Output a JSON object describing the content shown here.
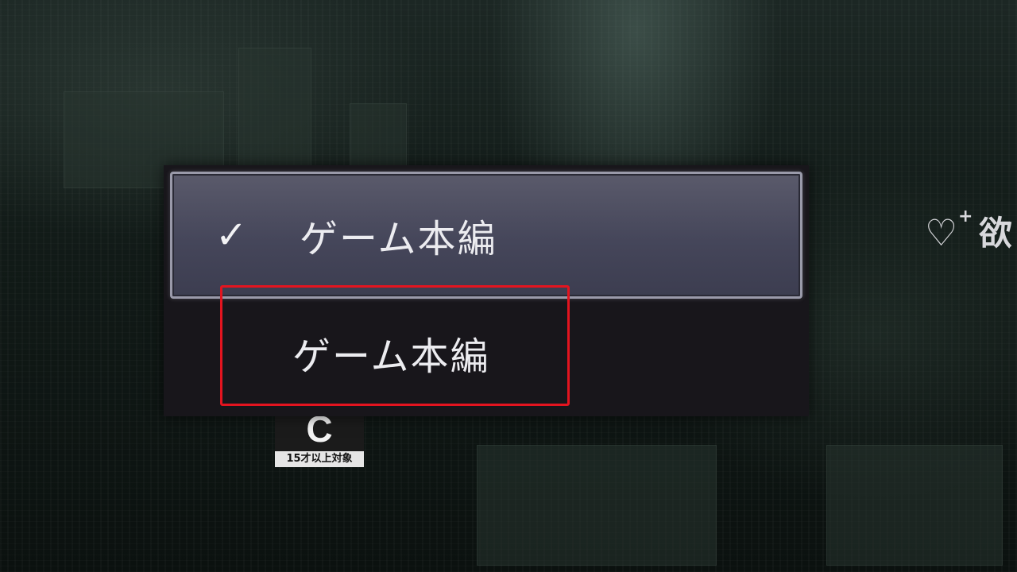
{
  "dropdown": {
    "options": [
      {
        "label": "ゲーム本編",
        "selected": true
      },
      {
        "label": "ゲーム本編",
        "selected": false
      }
    ]
  },
  "rating": {
    "letter": "C",
    "label": "15才以上対象"
  },
  "wishlist": {
    "label": "欲"
  },
  "colors": {
    "highlight": "#e3141f",
    "selected_bg": "#4a4b5e",
    "menu_bg": "#18161b"
  },
  "icons": {
    "check": "check-icon",
    "wishlist": "heart-plus-icon"
  }
}
